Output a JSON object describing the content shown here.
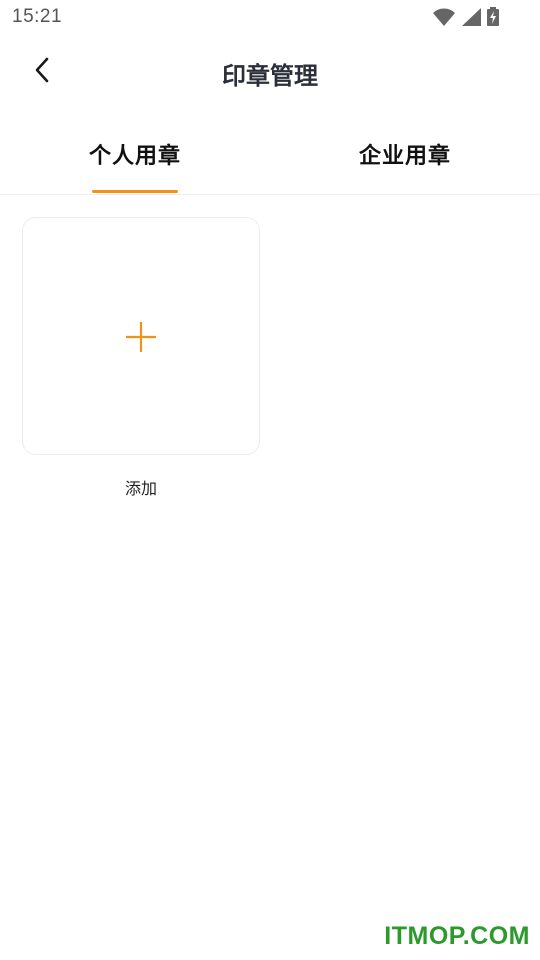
{
  "status_bar": {
    "time": "15:21",
    "icons": [
      "wifi-icon",
      "signal-icon",
      "battery-charging-icon"
    ]
  },
  "header": {
    "title": "印章管理",
    "back_icon": "chevron-left-icon"
  },
  "tabs": [
    {
      "label": "个人用章",
      "active": true
    },
    {
      "label": "企业用章",
      "active": false
    }
  ],
  "main": {
    "add_card": {
      "icon": "plus-icon",
      "label": "添加"
    }
  },
  "watermark": "ITMOP.COM",
  "colors": {
    "accent": "#f39219",
    "title_text": "#2a2f3a",
    "watermark": "#2b9a2b",
    "card_border": "#ececec"
  }
}
